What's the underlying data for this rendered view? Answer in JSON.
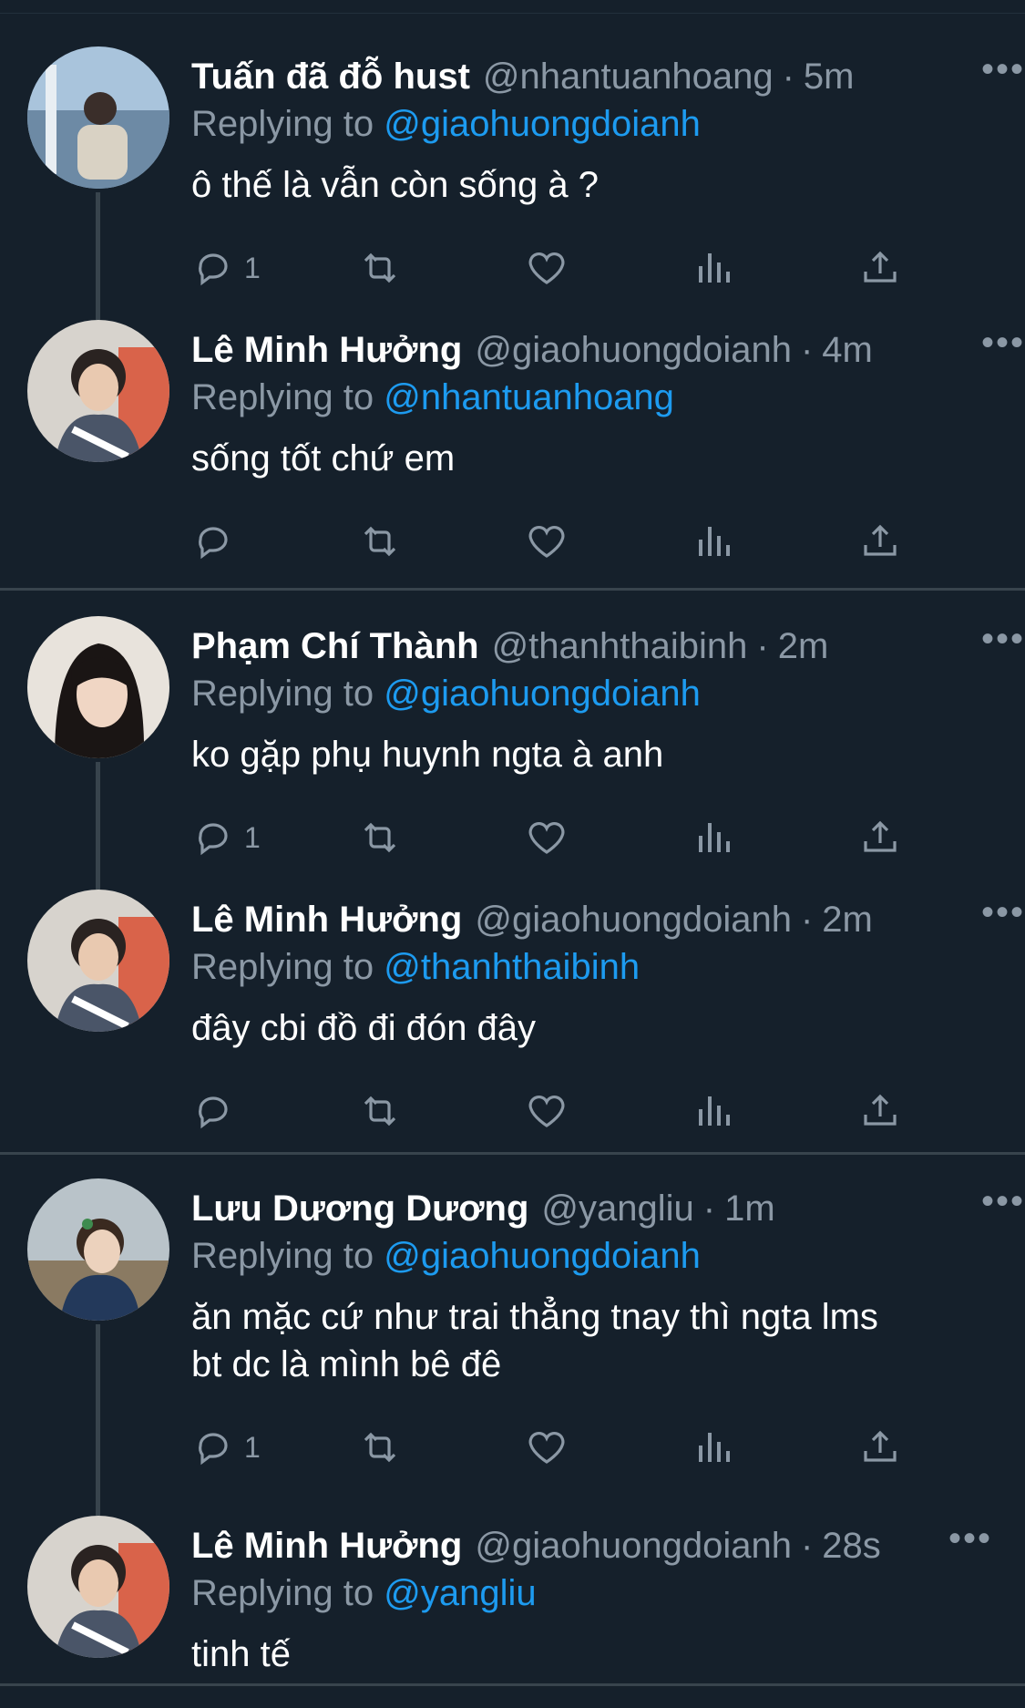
{
  "colors": {
    "background": "#15202b",
    "text": "#ffffff",
    "muted": "#8b98a5",
    "mention": "#1d9bf0",
    "thread_line": "#38444d"
  },
  "reply_prefix": "Replying to",
  "threads": [
    {
      "tweets": [
        {
          "name": "Tuấn đã đỗ hust",
          "handle": "@nhantuanhoang",
          "sep": "·",
          "time": "5m",
          "replying_to": "@giaohuongdoianh",
          "text": "ô thế là vẫn còn sống à ?",
          "reply_count": "1",
          "more": "•••"
        },
        {
          "name": "Lê Minh Hưởng",
          "handle": "@giaohuongdoianh",
          "sep": "·",
          "time": "4m",
          "replying_to": "@nhantuanhoang",
          "text": "sống tốt chứ em",
          "reply_count": "",
          "more": "•••"
        }
      ]
    },
    {
      "tweets": [
        {
          "name": "Phạm Chí Thành",
          "handle": "@thanhthaibinh",
          "sep": "·",
          "time": "2m",
          "replying_to": "@giaohuongdoianh",
          "text": "ko gặp phụ huynh ngta à anh",
          "reply_count": "1",
          "more": "•••"
        },
        {
          "name": "Lê Minh Hưởng",
          "handle": "@giaohuongdoianh",
          "sep": "·",
          "time": "2m",
          "replying_to": "@thanhthaibinh",
          "text": "đây cbi đồ đi đón đây",
          "reply_count": "",
          "more": "•••"
        }
      ]
    },
    {
      "tweets": [
        {
          "name": "Lưu Dương Dương",
          "handle": "@yangliu",
          "sep": "·",
          "time": "1m",
          "replying_to": "@giaohuongdoianh",
          "text": "ăn mặc cứ như trai thẳng tnay thì ngta lms\nbt dc là mình bê đê",
          "reply_count": "1",
          "more": "•••"
        },
        {
          "name": "Lê Minh Hưởng",
          "handle": "@giaohuongdoianh",
          "sep": "·",
          "time": "28s",
          "replying_to": "@yangliu",
          "text": "tinh tế",
          "reply_count": "",
          "more": "•••"
        }
      ]
    }
  ]
}
